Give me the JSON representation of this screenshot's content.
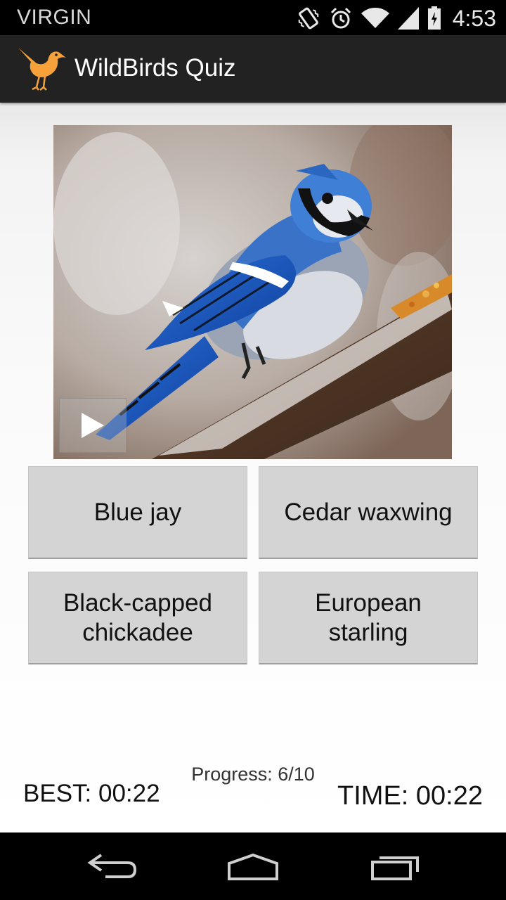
{
  "status_bar": {
    "carrier": "VIRGIN",
    "time": "4:53",
    "icons": [
      "vibrate-icon",
      "alarm-icon",
      "wifi-icon",
      "signal-icon",
      "battery-icon"
    ]
  },
  "app": {
    "title": "WildBirds Quiz",
    "logo_icon": "bird-logo-icon",
    "accent_color": "#f6a13a"
  },
  "quiz": {
    "image_subject": "blue jay on branch",
    "play_icon": "play-icon",
    "answers": [
      "Blue jay",
      "Cedar waxwing",
      "Black-capped chickadee",
      "European starling"
    ],
    "progress": "Progress: 6/10",
    "best": "BEST: 00:22",
    "time": "TIME: 00:22"
  },
  "nav": {
    "icons": [
      "back-icon",
      "home-icon",
      "recents-icon"
    ]
  }
}
